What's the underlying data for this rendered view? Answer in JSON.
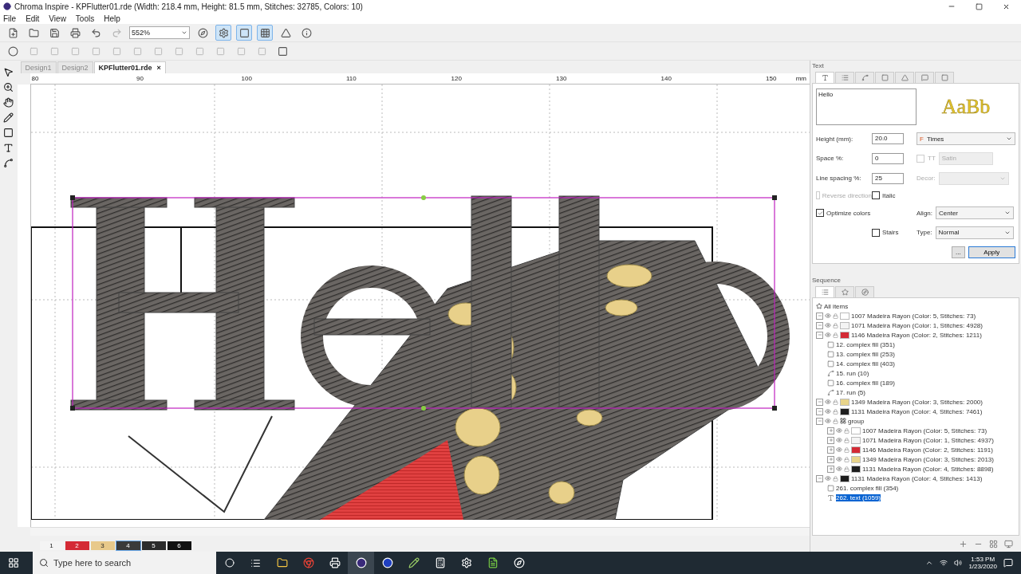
{
  "window": {
    "title": "Chroma Inspire - KPFlutter01.rde (Width: 218.4 mm, Height: 81.5 mm, Stitches: 32785, Colors: 10)"
  },
  "menu": [
    "File",
    "Edit",
    "View",
    "Tools",
    "Help"
  ],
  "zoom": {
    "value": "552%"
  },
  "doc_tabs": [
    {
      "label": "Design1",
      "selected": false
    },
    {
      "label": "Design2",
      "selected": false
    },
    {
      "label": "KPFlutter01.rde",
      "selected": true,
      "close": "×"
    }
  ],
  "ruler": {
    "marks": [
      "80",
      "90",
      "100",
      "110",
      "120",
      "130",
      "140",
      "150"
    ],
    "unit": "mm"
  },
  "text_panel": {
    "title": "Text",
    "tabs": [
      {
        "selected": true
      },
      {
        "selected": false
      },
      {
        "selected": false
      },
      {
        "selected": false
      },
      {
        "selected": false
      },
      {
        "selected": false
      },
      {
        "selected": false
      }
    ],
    "text": "Hello",
    "preview": "AaBb",
    "fields": [
      {
        "label": "Height (mm):",
        "value": "20.0"
      },
      {
        "label": "Space %:",
        "value": "0"
      },
      {
        "label": "Line spacing %:",
        "value": "25"
      }
    ],
    "font": "Times",
    "font_mark": "F",
    "tt": {
      "label": "TT",
      "checked": false
    },
    "stitch_type": "Satin",
    "decor_label": "Decor:",
    "checks": [
      {
        "label": "Reverse direction",
        "checked": false,
        "disabled": true
      },
      {
        "label": "Italic",
        "checked": false,
        "disabled": false
      },
      {
        "label": "Optimize colors",
        "checked": true,
        "disabled": false
      },
      {
        "label": "Stairs",
        "checked": false,
        "disabled": false
      }
    ],
    "align": {
      "label": "Align:",
      "value": "Center"
    },
    "type": {
      "label": "Type:",
      "value": "Normal"
    },
    "more": "...",
    "apply": "Apply"
  },
  "sequence": {
    "title": "Sequence",
    "tabs": [
      {
        "selected": true
      },
      {
        "selected": false
      },
      {
        "selected": false
      }
    ],
    "root": "All items",
    "items": [
      {
        "label": "1007 Madeira Rayon (Color: 5, Stitches: 73)",
        "kind": "thread",
        "color": "#ffffff",
        "expanded": true,
        "selected": false
      },
      {
        "label": "1071 Madeira Rayon (Color: 1, Stitches: 4928)",
        "kind": "thread",
        "color": "#f4f4f4",
        "expanded": true,
        "selected": false
      },
      {
        "label": "1146 Madeira Rayon (Color: 2, Stitches: 1211)",
        "kind": "thread",
        "color": "#d42a35",
        "expanded": true,
        "selected": false,
        "children": [
          {
            "label": "12. complex fill (351)",
            "kind": "fill",
            "selected": false
          },
          {
            "label": "13. complex fill (253)",
            "kind": "fill",
            "selected": false
          },
          {
            "label": "14. complex fill (403)",
            "kind": "fill",
            "selected": false
          },
          {
            "label": "15. run (10)",
            "kind": "run",
            "selected": false
          },
          {
            "label": "16. complex fill (189)",
            "kind": "fill",
            "selected": false
          },
          {
            "label": "17. run (5)",
            "kind": "run",
            "selected": false
          }
        ]
      },
      {
        "label": "1349 Madeira Rayon (Color: 3, Stitches: 2000)",
        "kind": "thread",
        "color": "#e8d48a",
        "expanded": true,
        "selected": false
      },
      {
        "label": "1131 Madeira Rayon (Color: 4, Stitches: 7461)",
        "kind": "thread",
        "color": "#1e1e1e",
        "expanded": true,
        "selected": false
      },
      {
        "label": "group",
        "kind": "group",
        "expanded": true,
        "selected": false,
        "children": [
          {
            "label": "1007 Madeira Rayon (Color: 5, Stitches: 73)",
            "kind": "thread",
            "color": "#ffffff",
            "expanded": false,
            "selected": false
          },
          {
            "label": "1071 Madeira Rayon (Color: 1, Stitches: 4937)",
            "kind": "thread",
            "color": "#f4f4f4",
            "expanded": false,
            "selected": false
          },
          {
            "label": "1146 Madeira Rayon (Color: 2, Stitches: 1191)",
            "kind": "thread",
            "color": "#d42a35",
            "expanded": false,
            "selected": false
          },
          {
            "label": "1349 Madeira Rayon (Color: 3, Stitches: 2013)",
            "kind": "thread",
            "color": "#e8d48a",
            "expanded": false,
            "selected": false
          },
          {
            "label": "1131 Madeira Rayon (Color: 4, Stitches: 8898)",
            "kind": "thread",
            "color": "#1e1e1e",
            "expanded": false,
            "selected": false
          }
        ]
      },
      {
        "label": "1131 Madeira Rayon (Color: 4, Stitches: 1413)",
        "kind": "thread",
        "color": "#1e1e1e",
        "expanded": true,
        "selected": false,
        "children": [
          {
            "label": "261. complex fill (354)",
            "kind": "fill",
            "selected": false
          },
          {
            "label": "262. text (1059)",
            "kind": "text",
            "selected": true
          }
        ]
      }
    ]
  },
  "palette": [
    {
      "label": "1",
      "color": "#f4f4f4",
      "selected": false
    },
    {
      "label": "2",
      "color": "#d42a35",
      "selected": false
    },
    {
      "label": "3",
      "color": "#e8c98a",
      "selected": false
    },
    {
      "label": "4",
      "color": "#3a3a3a",
      "selected": true
    },
    {
      "label": "5",
      "color": "#2b2b2b",
      "selected": false
    },
    {
      "label": "6",
      "color": "#111111",
      "selected": false
    }
  ],
  "taskbar": {
    "search_placeholder": "Type here to search",
    "time": "1:53 PM",
    "date": "1/23/2020"
  }
}
